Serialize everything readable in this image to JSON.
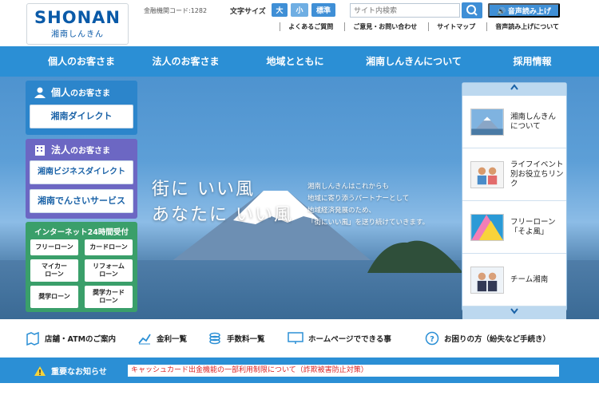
{
  "header": {
    "logo_main": "SHONAN",
    "logo_sub": "湘南しんきん",
    "bank_code": "金融機関コード:1282",
    "font_size_label": "文字サイズ",
    "font_large": "大",
    "font_small": "小",
    "font_standard": "標準",
    "search_placeholder": "サイト内検索",
    "voice_button": "音声読み上げ",
    "sub_links": [
      "よくあるご質問",
      "ご意見・お問い合わせ",
      "サイトマップ",
      "音声読み上げについて"
    ]
  },
  "nav": {
    "items": [
      "個人のお客さま",
      "法人のお客さま",
      "地域とともに",
      "湘南しんきんについて",
      "採用情報"
    ]
  },
  "hero": {
    "title_line1": "街に いい風",
    "title_line2": "あなたに いい風",
    "desc_lines": [
      "湘南しんきんはこれからも",
      "地域に寄り添うパートナーとして",
      "地域経済発展のため、",
      "「街にいい風」を送り続けていきます。"
    ]
  },
  "left": {
    "personal_head": "個人のお客さま",
    "personal_big": "個人",
    "personal_rest": "のお客さま",
    "direct_button": "湘南ダイレクト",
    "corp_big": "法人",
    "corp_rest": "のお客さま",
    "biz_direct_button": "湘南ビジネスダイレクト",
    "densai_button": "湘南でんさいサービス",
    "net_head": "インターネット24時間受付",
    "loans": [
      "フリーローン",
      "カードローン",
      "マイカー\nローン",
      "リフォーム\nローン",
      "奨学ローン",
      "奨学カード\nローン"
    ]
  },
  "right": {
    "items": [
      "湘南しんきん\nについて",
      "ライフイベント別お役立ちリンク",
      "フリーローン\n「そよ風」",
      "チーム湘南"
    ],
    "up_arrow": "^",
    "down_arrow": "v"
  },
  "quick": {
    "items": [
      "店舗・ATMのご案内",
      "金利一覧",
      "手数料一覧",
      "ホームページでできる事",
      "お困りの方（紛失など手続き）"
    ]
  },
  "notice": {
    "label": "重要なお知らせ",
    "text": "キャッシュカード出金機能の一部利用制限について（詐欺被害防止対策）"
  },
  "colors": {
    "brand_blue": "#2b8fd5",
    "corp_purple": "#6c67c3",
    "net_green": "#3a9f6a",
    "logo_orange": "#f3a419"
  }
}
